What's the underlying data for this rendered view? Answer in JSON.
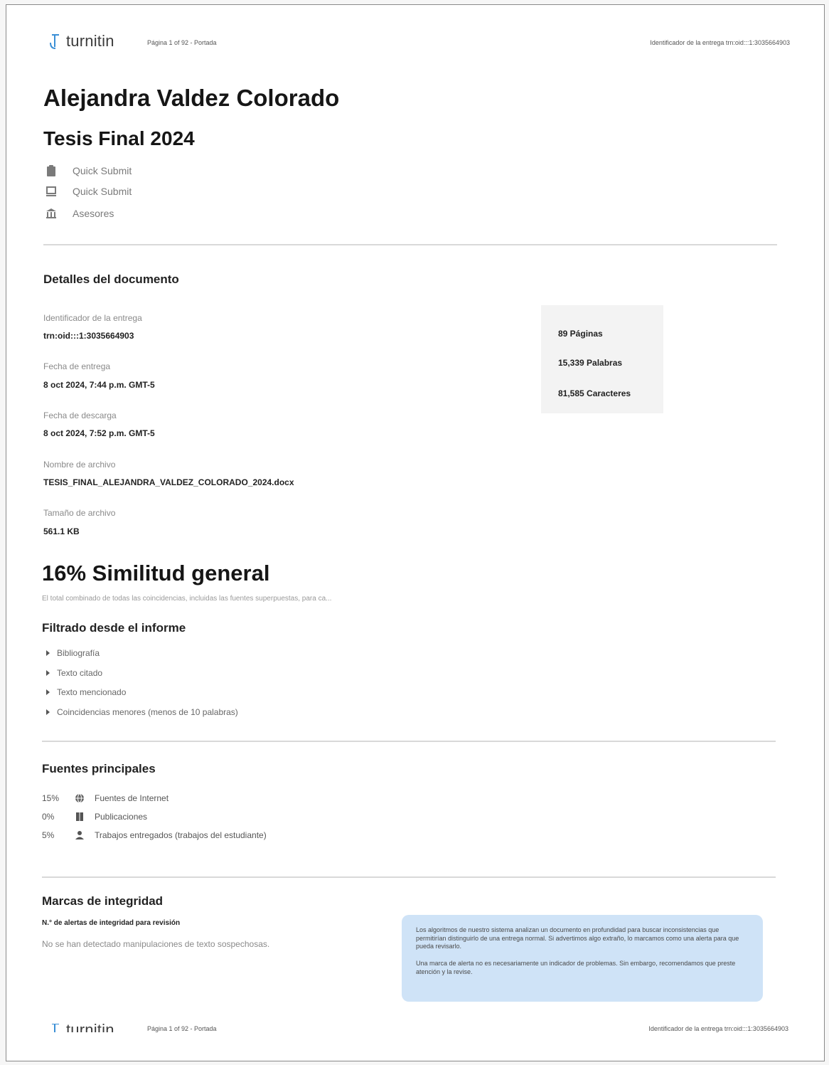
{
  "header": {
    "logo_text": "turnitin",
    "page_info": "Página 1 of 92 - Portada",
    "submission_id": "Identificador de la entrega trn:oid:::1:3035664903"
  },
  "document": {
    "author": "Alejandra Valdez Colorado",
    "title": "Tesis Final 2024",
    "meta": [
      {
        "icon": "clipboard-icon",
        "text": "Quick Submit"
      },
      {
        "icon": "inbox-icon",
        "text": "Quick Submit"
      },
      {
        "icon": "bank-icon",
        "text": "Asesores"
      }
    ]
  },
  "details": {
    "heading": "Detalles del documento",
    "fields": [
      {
        "label": "Identificador de la entrega",
        "value": "trn:oid:::1:3035664903"
      },
      {
        "label": "Fecha de entrega",
        "value": "8 oct 2024, 7:44 p.m. GMT-5"
      },
      {
        "label": "Fecha de descarga",
        "value": "8 oct 2024, 7:52 p.m. GMT-5"
      },
      {
        "label": "Nombre de archivo",
        "value": "TESIS_FINAL_ALEJANDRA_VALDEZ_COLORADO_2024.docx"
      },
      {
        "label": "Tamaño de archivo",
        "value": "561.1 KB"
      }
    ],
    "stats": [
      "89 Páginas",
      "15,339 Palabras",
      "81,585 Caracteres"
    ]
  },
  "similarity": {
    "headline": "16% Similitud general",
    "description": "El total combinado de todas las coincidencias, incluidas las fuentes superpuestas, para ca..."
  },
  "filters": {
    "heading": "Filtrado desde el informe",
    "items": [
      "Bibliografía",
      "Texto citado",
      "Texto mencionado",
      "Coincidencias menores (menos de 10 palabras)"
    ]
  },
  "sources": {
    "heading": "Fuentes principales",
    "items": [
      {
        "pct": "15%",
        "icon": "globe-icon",
        "label": "Fuentes de Internet"
      },
      {
        "pct": "0%",
        "icon": "book-icon",
        "label": "Publicaciones"
      },
      {
        "pct": "5%",
        "icon": "person-icon",
        "label": "Trabajos entregados (trabajos del estudiante)"
      }
    ]
  },
  "integrity": {
    "heading": "Marcas de integridad",
    "alerts_label": "N.° de alertas de integridad para revisión",
    "alerts_text": "No se han detectado manipulaciones de texto sospechosas.",
    "info_p1": "Los algoritmos de nuestro sistema analizan un documento en profundidad para buscar inconsistencias que permitirían distinguirlo de una entrega normal. Si advertimos algo extraño, lo marcamos como una alerta para que pueda revisarlo.",
    "info_p2": "Una marca de alerta no es necesariamente un indicador de problemas. Sin embargo, recomendamos que preste atención y la revise."
  },
  "colors": {
    "info_box": "#cfe3f7",
    "logo_accent": "#3a8fd6"
  }
}
